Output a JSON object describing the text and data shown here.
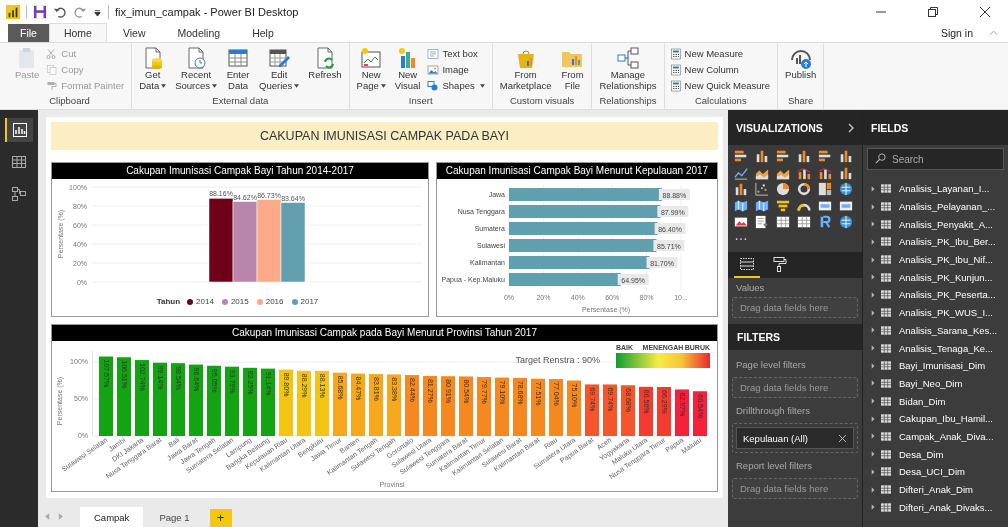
{
  "window": {
    "title": "fix_imun_campak - Power BI Desktop",
    "sign_in": "Sign in"
  },
  "menu_tabs": [
    {
      "label": "File",
      "kind": "file",
      "selected": false
    },
    {
      "label": "Home",
      "kind": "tab",
      "selected": true
    },
    {
      "label": "View",
      "kind": "tab",
      "selected": false
    },
    {
      "label": "Modeling",
      "kind": "tab",
      "selected": false
    },
    {
      "label": "Help",
      "kind": "tab",
      "selected": false
    }
  ],
  "ribbon": {
    "groups": [
      {
        "label": "Clipboard",
        "columns": [
          {
            "kind": "large",
            "lines": [
              "Paste"
            ],
            "dropdown": false,
            "disabled": true
          },
          {
            "kind": "stack",
            "items": [
              {
                "label": "Cut",
                "dropdown": false,
                "disabled": true
              },
              {
                "label": "Copy",
                "dropdown": false,
                "disabled": true
              },
              {
                "label": "Format Painter",
                "dropdown": false,
                "disabled": true
              }
            ]
          }
        ]
      },
      {
        "label": "External data",
        "columns": [
          {
            "kind": "large",
            "lines": [
              "Get",
              "Data"
            ],
            "dropdown": true,
            "disabled": false
          },
          {
            "kind": "large",
            "lines": [
              "Recent",
              "Sources"
            ],
            "dropdown": true,
            "disabled": false
          },
          {
            "kind": "large",
            "lines": [
              "Enter",
              "Data"
            ],
            "dropdown": false,
            "disabled": false
          },
          {
            "kind": "large",
            "lines": [
              "Edit",
              "Queries"
            ],
            "dropdown": true,
            "disabled": false
          },
          {
            "kind": "large",
            "lines": [
              "Refresh"
            ],
            "dropdown": false,
            "disabled": false
          }
        ]
      },
      {
        "label": "Insert",
        "columns": [
          {
            "kind": "large",
            "lines": [
              "New",
              "Page"
            ],
            "dropdown": true,
            "disabled": false
          },
          {
            "kind": "large",
            "lines": [
              "New",
              "Visual"
            ],
            "dropdown": false,
            "disabled": false
          },
          {
            "kind": "stack",
            "items": [
              {
                "label": "Text box",
                "dropdown": false,
                "disabled": false
              },
              {
                "label": "Image",
                "dropdown": false,
                "disabled": false
              },
              {
                "label": "Shapes",
                "dropdown": true,
                "disabled": false
              }
            ]
          }
        ]
      },
      {
        "label": "Custom visuals",
        "columns": [
          {
            "kind": "large",
            "lines": [
              "From",
              "Marketplace"
            ],
            "dropdown": false,
            "disabled": false
          },
          {
            "kind": "large",
            "lines": [
              "From",
              "File"
            ],
            "dropdown": false,
            "disabled": false
          }
        ]
      },
      {
        "label": "Relationships",
        "columns": [
          {
            "kind": "large",
            "lines": [
              "Manage",
              "Relationships"
            ],
            "dropdown": false,
            "disabled": false
          }
        ]
      },
      {
        "label": "Calculations",
        "columns": [
          {
            "kind": "stack",
            "items": [
              {
                "label": "New Measure",
                "dropdown": false,
                "disabled": false
              },
              {
                "label": "New Column",
                "dropdown": false,
                "disabled": false
              },
              {
                "label": "New Quick Measure",
                "dropdown": false,
                "disabled": false
              }
            ]
          }
        ]
      },
      {
        "label": "Share",
        "columns": [
          {
            "kind": "large",
            "lines": [
              "Publish"
            ],
            "dropdown": false,
            "disabled": false
          }
        ]
      }
    ]
  },
  "views": [
    {
      "selected": true
    },
    {
      "selected": false
    },
    {
      "selected": false
    }
  ],
  "report": {
    "banner": "CAKUPAN IMUNISASI CAMPAK PADA BAYI",
    "visuals": [
      {
        "chart_data": {
          "type": "bar",
          "title": "Cakupan Imunisasi Campak Bayi Tahun 2014-2017",
          "ylabel": "Persentase (%)",
          "ylim": [
            0,
            100
          ],
          "grid": true,
          "legend": {
            "title": "Tahun"
          },
          "yticks": [
            {
              "value": 0,
              "label": "0%"
            },
            {
              "value": 20,
              "label": "20%"
            },
            {
              "value": 40,
              "label": "40%"
            },
            {
              "value": 60,
              "label": "60%"
            },
            {
              "value": 80,
              "label": "80%"
            },
            {
              "value": 100,
              "label": "100%"
            }
          ],
          "series": [
            {
              "name": "2014",
              "color": "#6f0019",
              "values": [
                88.16
              ]
            },
            {
              "name": "2015",
              "color": "#b886ad",
              "values": [
                84.62
              ]
            },
            {
              "name": "2016",
              "color": "#fba987",
              "values": [
                86.73
              ]
            },
            {
              "name": "2017",
              "color": "#62a0b0",
              "values": [
                83.64
              ]
            }
          ],
          "value_labels": [
            "88.16%",
            "84.62%",
            "86.73%",
            "83.64%"
          ]
        }
      },
      {
        "chart_data": {
          "type": "bar",
          "orientation": "horizontal",
          "title": "Cakupan Imunisasi Campak Bayi Menurut Kepulauan 2017",
          "xlabel": "Persentase (%)",
          "xlim": [
            0,
            100
          ],
          "grid": true,
          "categories": [
            "Jawa",
            "Nusa Tenggara",
            "Sumatera",
            "Sulawesi",
            "Kalimantan",
            "Papua - Kep.Maluku"
          ],
          "xticks": [
            {
              "value": 0,
              "label": "0%"
            },
            {
              "value": 20,
              "label": "20%"
            },
            {
              "value": 40,
              "label": "40%"
            },
            {
              "value": 60,
              "label": "60%"
            },
            {
              "value": 80,
              "label": "80%"
            },
            {
              "value": 100,
              "label": "10..."
            }
          ],
          "series": [
            {
              "color": "#5f9fae",
              "values": [
                88.88,
                87.99,
                86.4,
                85.71,
                81.7,
                64.95
              ]
            }
          ],
          "value_labels": [
            "88.88%",
            "87.99%",
            "86.40%",
            "85.71%",
            "81.70%",
            "64.95%"
          ]
        }
      },
      {
        "legend_scale": [
          "BAIK",
          "MENENGAH",
          "BURUK"
        ],
        "chart_data": {
          "type": "bar",
          "title": "Cakupan Imunisasi Campak pada Bayi Menurut Provinsi Tahun 2017",
          "xlabel": "Provinsi",
          "ylabel": "Persentase (%)",
          "ylim": [
            0,
            115
          ],
          "grid": true,
          "yticks": [
            {
              "value": 0,
              "label": "0%"
            },
            {
              "value": 50,
              "label": "50%"
            },
            {
              "value": 100,
              "label": "100%"
            }
          ],
          "categories": [
            "Sulawesi Selatan",
            "Jambi",
            "DKI Jakarta",
            "Nusa Tenggara Barat",
            "Bali",
            "Jawa Barat",
            "Jawa Tengah",
            "Sumatera Selatan",
            "Lampung",
            "Bangka Belitung",
            "Kepulauan Riau",
            "Kalimantan Utara",
            "Bengkulu",
            "Jawa Timur",
            "Banten",
            "Kalimantan Tengah",
            "Sulawesi Tengah",
            "Gorontalo",
            "Sulawesi Utara",
            "Sulawesi Tenggara",
            "Sumatera Barat",
            "Kalimantan Timur",
            "Kalimantan Selatan",
            "Sulawesi Barat",
            "Kalimantan Barat",
            "Riau",
            "Sumatera Utara",
            "Papua Barat",
            "Aceh",
            "Yogyakarta",
            "Maluku Utara",
            "Nusa Tenggara Timur",
            "Papua",
            "Maluku"
          ],
          "series": [
            {
              "values": [
                107.57,
                106.51,
                102.74,
                99.14,
                98.54,
                96.64,
                95.05,
                93.79,
                92.25,
                91.14,
                89.8,
                88.29,
                88.13,
                85.68,
                84.47,
                83.81,
                83.38,
                82.44,
                81.27,
                80.91,
                80.54,
                79.77,
                79.1,
                78.68,
                77.51,
                77.04,
                75.1,
                69.74,
                69.74,
                68.68,
                66.56,
                66.29,
                62.97,
                60.54
              ],
              "colors": [
                "#13a313",
                "#13a313",
                "#13a313",
                "#13a313",
                "#13a313",
                "#13a313",
                "#13a313",
                "#13a313",
                "#13a313",
                "#13a313",
                "#f2c515",
                "#f2c515",
                "#f2c515",
                "#f5a81c",
                "#f5a81c",
                "#f5a81c",
                "#f5a81c",
                "#f5891f",
                "#f5891f",
                "#f5891f",
                "#f5891f",
                "#f5891f",
                "#f5891f",
                "#f5891f",
                "#f5891f",
                "#f5891f",
                "#f5891f",
                "#f5552a",
                "#f5552a",
                "#f5552a",
                "#f53a30",
                "#f53a30",
                "#f5203a",
                "#f5203a"
              ]
            }
          ],
          "value_labels": [
            "107.57%",
            "106.51%",
            "102.74%",
            "99.14%",
            "98.54%",
            "96.64%",
            "95.05%",
            "93.79%",
            "92.25%",
            "91.14%",
            "89.80%",
            "88.29%",
            "88.13%",
            "85.68%",
            "84.47%",
            "83.81%",
            "83.38%",
            "82.44%",
            "81.27%",
            "80.91%",
            "80.54%",
            "79.77%",
            "79.10%",
            "78.68%",
            "77.51%",
            "77.04%",
            "75.10%",
            "69.74%",
            "69.74%",
            "68.68%",
            "66.56%",
            "66.29%",
            "62.97%",
            "60.54%"
          ],
          "annotations": [
            {
              "text": "Target Renstra : 90%"
            }
          ]
        }
      }
    ]
  },
  "page_tabs": [
    {
      "label": "Campak",
      "selected": true
    },
    {
      "label": "Page 1",
      "selected": false
    }
  ],
  "add_page_label": "+",
  "visualizations": {
    "title": "VISUALIZATIONS",
    "pane_tabs": [
      {
        "selected": true
      },
      {
        "selected": false
      }
    ],
    "wells": [
      {
        "label": "Values",
        "drop_hint": "Drag data fields here"
      }
    ]
  },
  "filters": {
    "title": "FILTERS",
    "sections": [
      {
        "label": "Page level filters",
        "drop_hint": "Drag data fields here"
      },
      {
        "label": "Drillthrough filters",
        "cards": [
          {
            "text": "Kepulauan (All)"
          }
        ]
      },
      {
        "label": "Report level filters",
        "drop_hint": "Drag data fields here"
      }
    ]
  },
  "fields": {
    "title": "FIELDS",
    "search": {
      "placeholder": "Search"
    },
    "tables": [
      {
        "name": "Analisis_Layanan_I...",
        "expanded": false
      },
      {
        "name": "Analisis_Pelayanan_...",
        "expanded": false
      },
      {
        "name": "Analisis_Penyakit_A...",
        "expanded": false
      },
      {
        "name": "Analisis_PK_Ibu_Ber...",
        "expanded": false
      },
      {
        "name": "Analisis_PK_Ibu_Nif...",
        "expanded": false
      },
      {
        "name": "Analisis_PK_Kunjun...",
        "expanded": false
      },
      {
        "name": "Analisis_PK_Peserta...",
        "expanded": false
      },
      {
        "name": "Analisis_PK_WUS_I...",
        "expanded": false
      },
      {
        "name": "Analisis_Sarana_Kes...",
        "expanded": false
      },
      {
        "name": "Analisis_Tenaga_Ke...",
        "expanded": false
      },
      {
        "name": "Bayi_Imunisasi_Dim",
        "expanded": false
      },
      {
        "name": "Bayi_Neo_Dim",
        "expanded": false
      },
      {
        "name": "Bidan_Dim",
        "expanded": false
      },
      {
        "name": "Cakupan_Ibu_Hamil...",
        "expanded": false
      },
      {
        "name": "Campak_Anak_Diva...",
        "expanded": false
      },
      {
        "name": "Desa_Dim",
        "expanded": false
      },
      {
        "name": "Desa_UCI_Dim",
        "expanded": false
      },
      {
        "name": "Difteri_Anak_Dim",
        "expanded": false
      },
      {
        "name": "Difteri_Anak_Divaks...",
        "expanded": false
      }
    ]
  }
}
